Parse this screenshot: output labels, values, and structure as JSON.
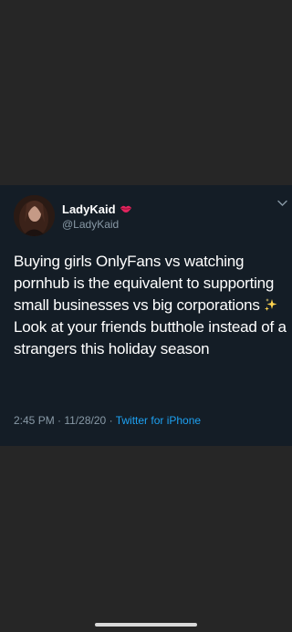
{
  "tweet": {
    "display_name": "LadyKaid",
    "handle": "@LadyKaid",
    "verified_icon": "lips-icon",
    "text_lines": [
      "Buying girls OnlyFans vs watching pornhub is the equivalent to supporting small businesses vs big corporations",
      "Look at your friends butthole instead of a strangers this holiday season"
    ],
    "sparkles_icon": "sparkles-icon",
    "time": "2:45 PM",
    "date": "11/28/20",
    "separator": "·",
    "source": "Twitter for iPhone"
  },
  "colors": {
    "page_background": "#262626",
    "tweet_background": "#141d26",
    "text_primary": "#ffffff",
    "text_secondary": "#8899a6",
    "link": "#1da1f2"
  }
}
